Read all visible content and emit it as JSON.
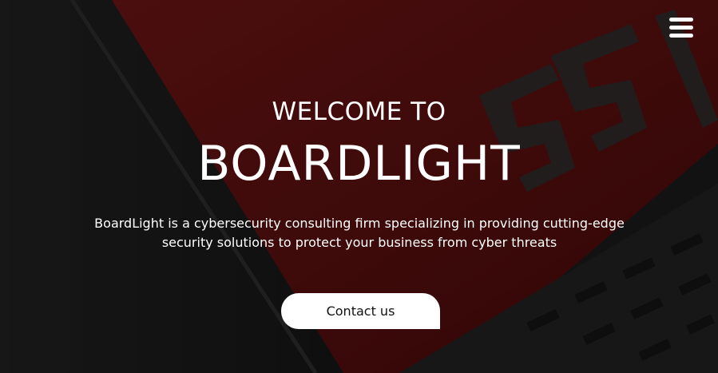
{
  "header": {
    "menu_icon": "hamburger-menu-icon"
  },
  "hero": {
    "welcome": "WELCOME TO",
    "brand": "BOARDLIGHT",
    "description": "BoardLight is a cybersecurity consulting firm specializing in providing cutting-edge security solutions to protect your business from cyber threats",
    "cta_label": "Contact us"
  },
  "colors": {
    "accent_red": "#7a1414",
    "text": "#ffffff",
    "button_bg": "#ffffff",
    "button_text": "#111111"
  }
}
